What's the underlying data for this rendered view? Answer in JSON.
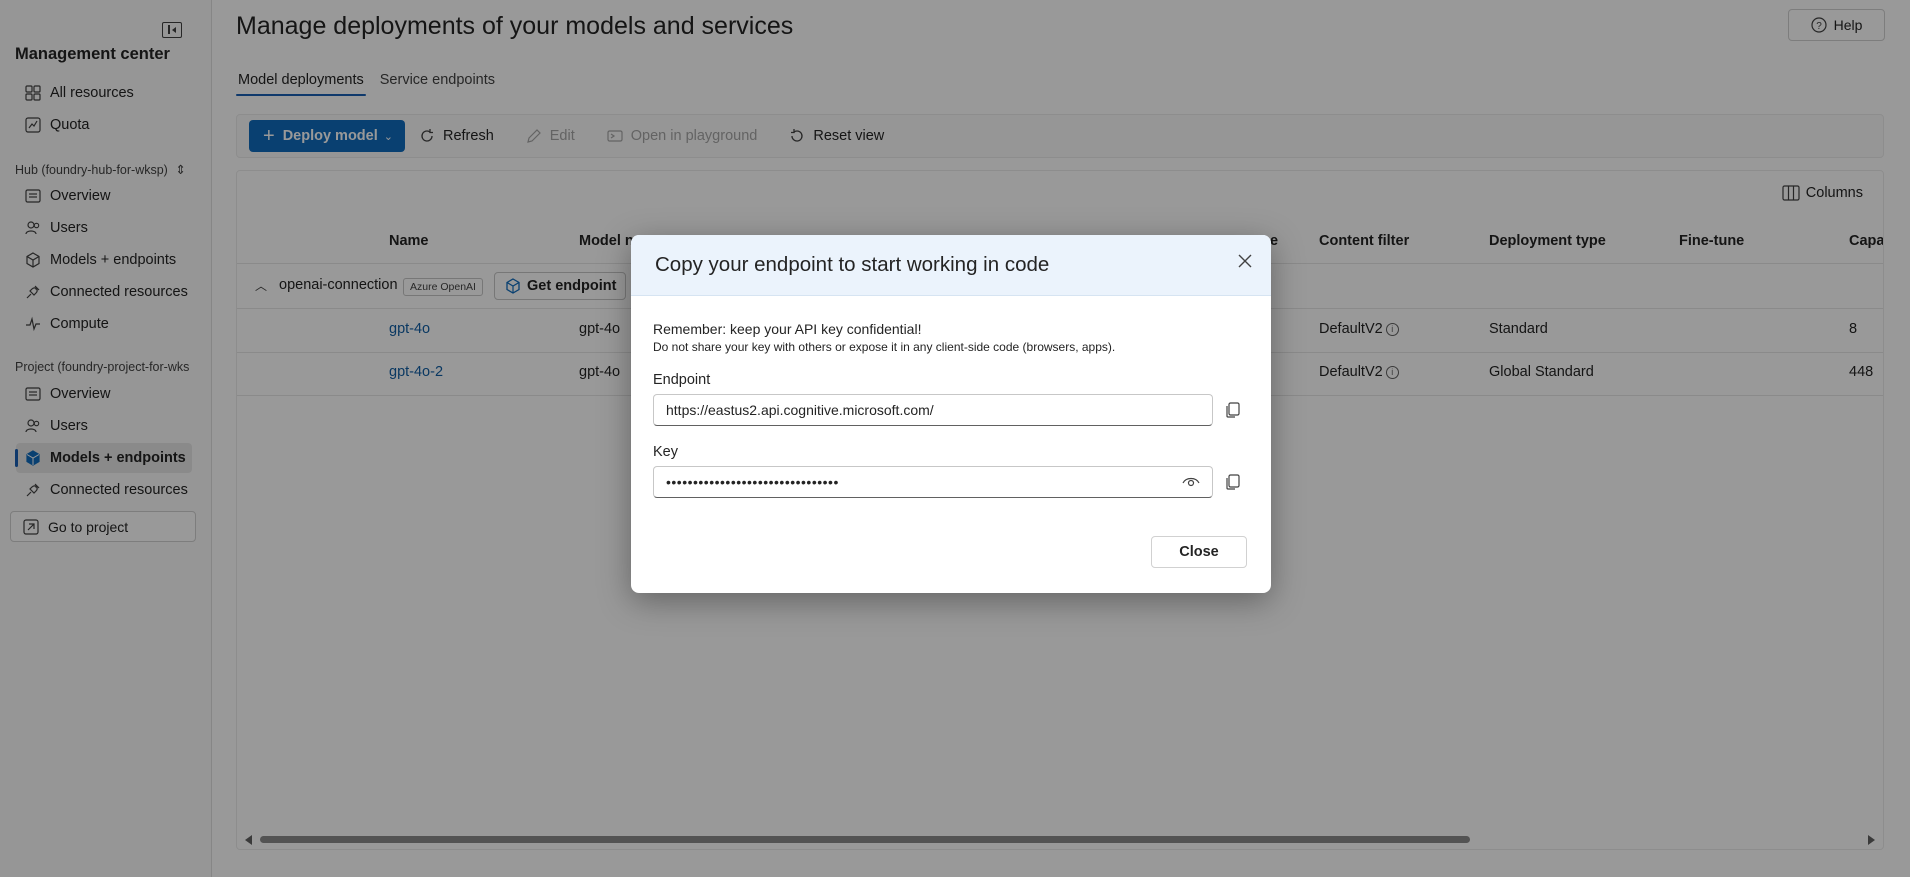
{
  "sidebar": {
    "title": "Management center",
    "top_items": [
      {
        "label": "All resources",
        "icon": "grid-icon"
      },
      {
        "label": "Quota",
        "icon": "gauge-icon"
      }
    ],
    "hub_section": "Hub (foundry-hub-for-wksp)",
    "hub_items": [
      {
        "label": "Overview",
        "icon": "overview-icon"
      },
      {
        "label": "Users",
        "icon": "users-icon"
      },
      {
        "label": "Models + endpoints",
        "icon": "cube-icon"
      },
      {
        "label": "Connected resources",
        "icon": "plug-icon"
      },
      {
        "label": "Compute",
        "icon": "pulse-icon"
      }
    ],
    "project_section": "Project (foundry-project-for-wks",
    "project_items": [
      {
        "label": "Overview",
        "icon": "overview-icon"
      },
      {
        "label": "Users",
        "icon": "users-icon"
      },
      {
        "label": "Models + endpoints",
        "icon": "cube-icon",
        "active": true
      },
      {
        "label": "Connected resources",
        "icon": "plug-icon"
      }
    ],
    "go_to_project": "Go to project"
  },
  "header": {
    "title": "Manage deployments of your models and services",
    "help": "Help"
  },
  "tabs": [
    {
      "label": "Model deployments",
      "active": true
    },
    {
      "label": "Service endpoints",
      "active": false
    }
  ],
  "toolbar": {
    "deploy": "Deploy model",
    "refresh": "Refresh",
    "edit": "Edit",
    "open_playground": "Open in playground",
    "reset_view": "Reset view"
  },
  "grid": {
    "columns_button": "Columns",
    "headers": {
      "name": "Name",
      "model_name": "Model na",
      "hidden_col": "e",
      "content_filter": "Content filter",
      "deployment_type": "Deployment type",
      "fine_tune": "Fine-tune",
      "capacity": "Capac"
    },
    "group": {
      "name": "openai-connection",
      "badge": "Azure OpenAI",
      "get_endpoint": "Get endpoint"
    },
    "rows": [
      {
        "name": "gpt-4o",
        "model": "gpt-4o",
        "content_filter": "DefaultV2",
        "deployment_type": "Standard",
        "capacity": "8"
      },
      {
        "name": "gpt-4o-2",
        "model": "gpt-4o",
        "content_filter": "DefaultV2",
        "deployment_type": "Global Standard",
        "capacity": "448"
      }
    ]
  },
  "dialog": {
    "title": "Copy your endpoint to start working in code",
    "warning": "Remember: keep your API key confidential!",
    "warning_sub": "Do not share your key with others or expose it in any client-side code (browsers, apps).",
    "endpoint_label": "Endpoint",
    "endpoint_value": "https://eastus2.api.cognitive.microsoft.com/",
    "key_label": "Key",
    "key_masked": "••••••••••••••••••••••••••••••••",
    "close": "Close"
  },
  "colors": {
    "accent": "#0f6cbd",
    "link": "#115ea3",
    "dialog_header": "#ebf3fc"
  }
}
